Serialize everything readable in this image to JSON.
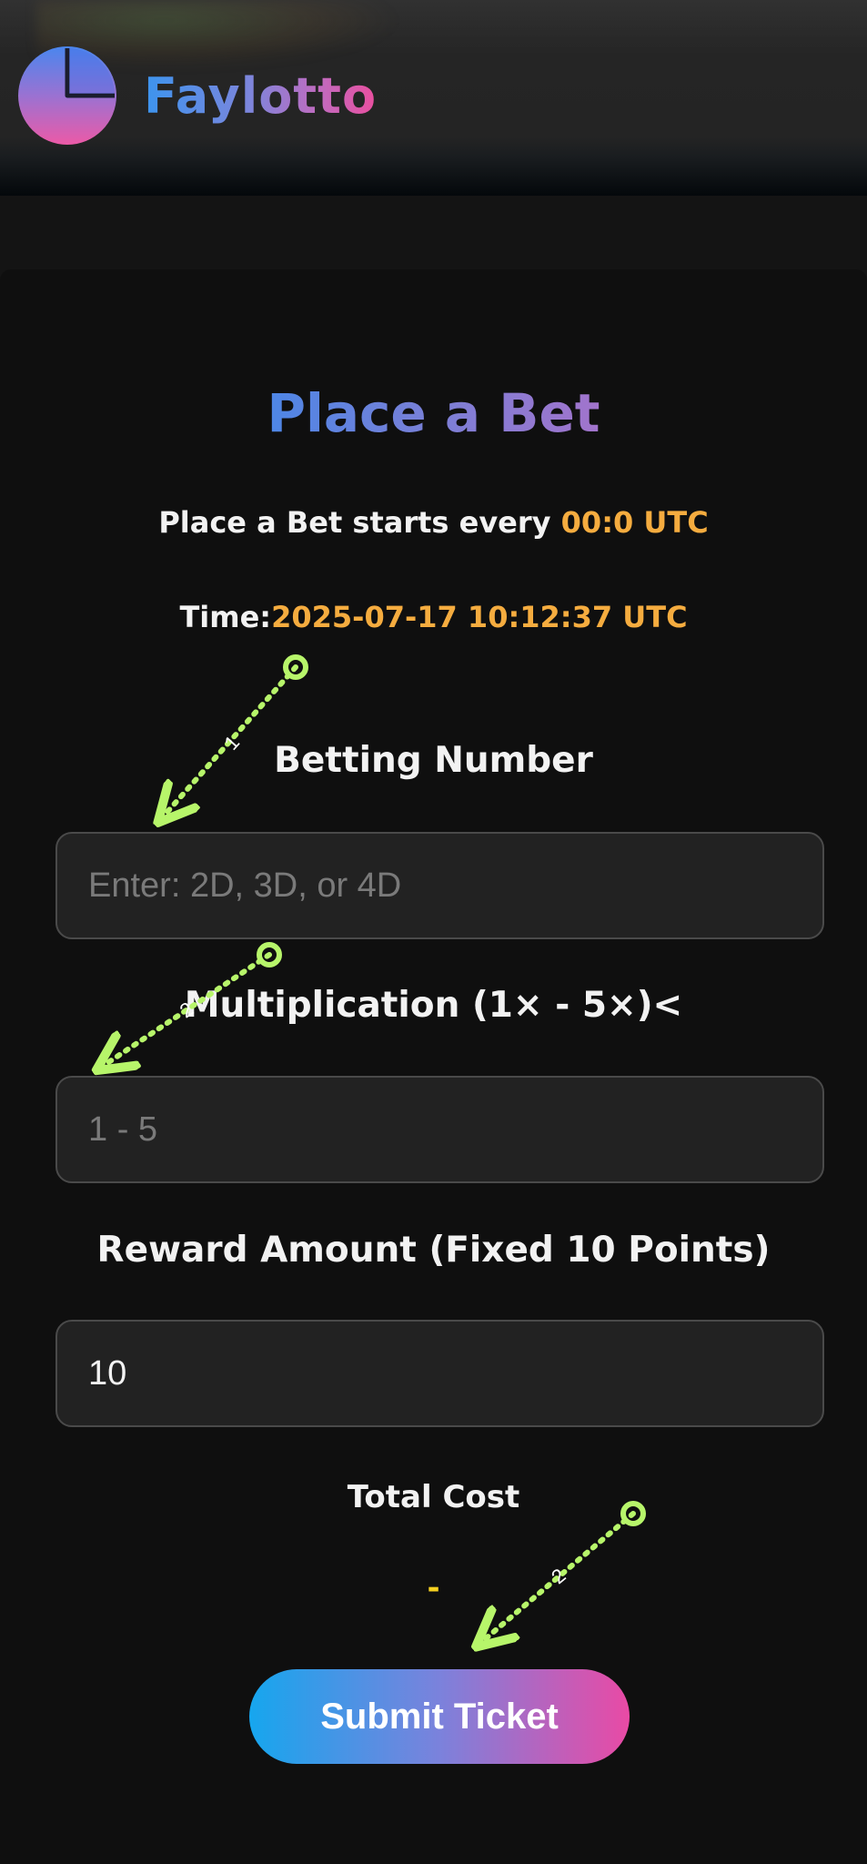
{
  "header": {
    "brand": "Faylotto",
    "logo_icon": "pie-chart-logo-icon"
  },
  "form": {
    "title": "Place a Bet",
    "schedule_prefix": "Place a Bet starts every ",
    "schedule_time": "00:0 UTC",
    "time_label": "Time:",
    "time_value": "2025-07-17 10:12:37 UTC",
    "betting_number_label": "Betting Number",
    "betting_number_placeholder": "Enter: 2D, 3D, or 4D",
    "betting_number_value": "",
    "multiplication_label": "Multiplication (1× - 5×)<",
    "multiplication_placeholder": "1 - 5",
    "multiplication_value": "",
    "reward_label": "Reward Amount (Fixed 10 Points)",
    "reward_value": "10",
    "total_cost_label": "Total Cost",
    "total_cost_value": "-",
    "submit_label": "Submit Ticket"
  },
  "annotations": [
    {
      "label": "1"
    },
    {
      "label": "2"
    },
    {
      "label": "2"
    }
  ],
  "colors": {
    "accent_orange": "#f5ac3f",
    "total_yellow": "#f5d020",
    "annotation_green": "#b7f56a",
    "gradient_blue": "#16a6ee",
    "gradient_pink": "#e94aa5"
  }
}
